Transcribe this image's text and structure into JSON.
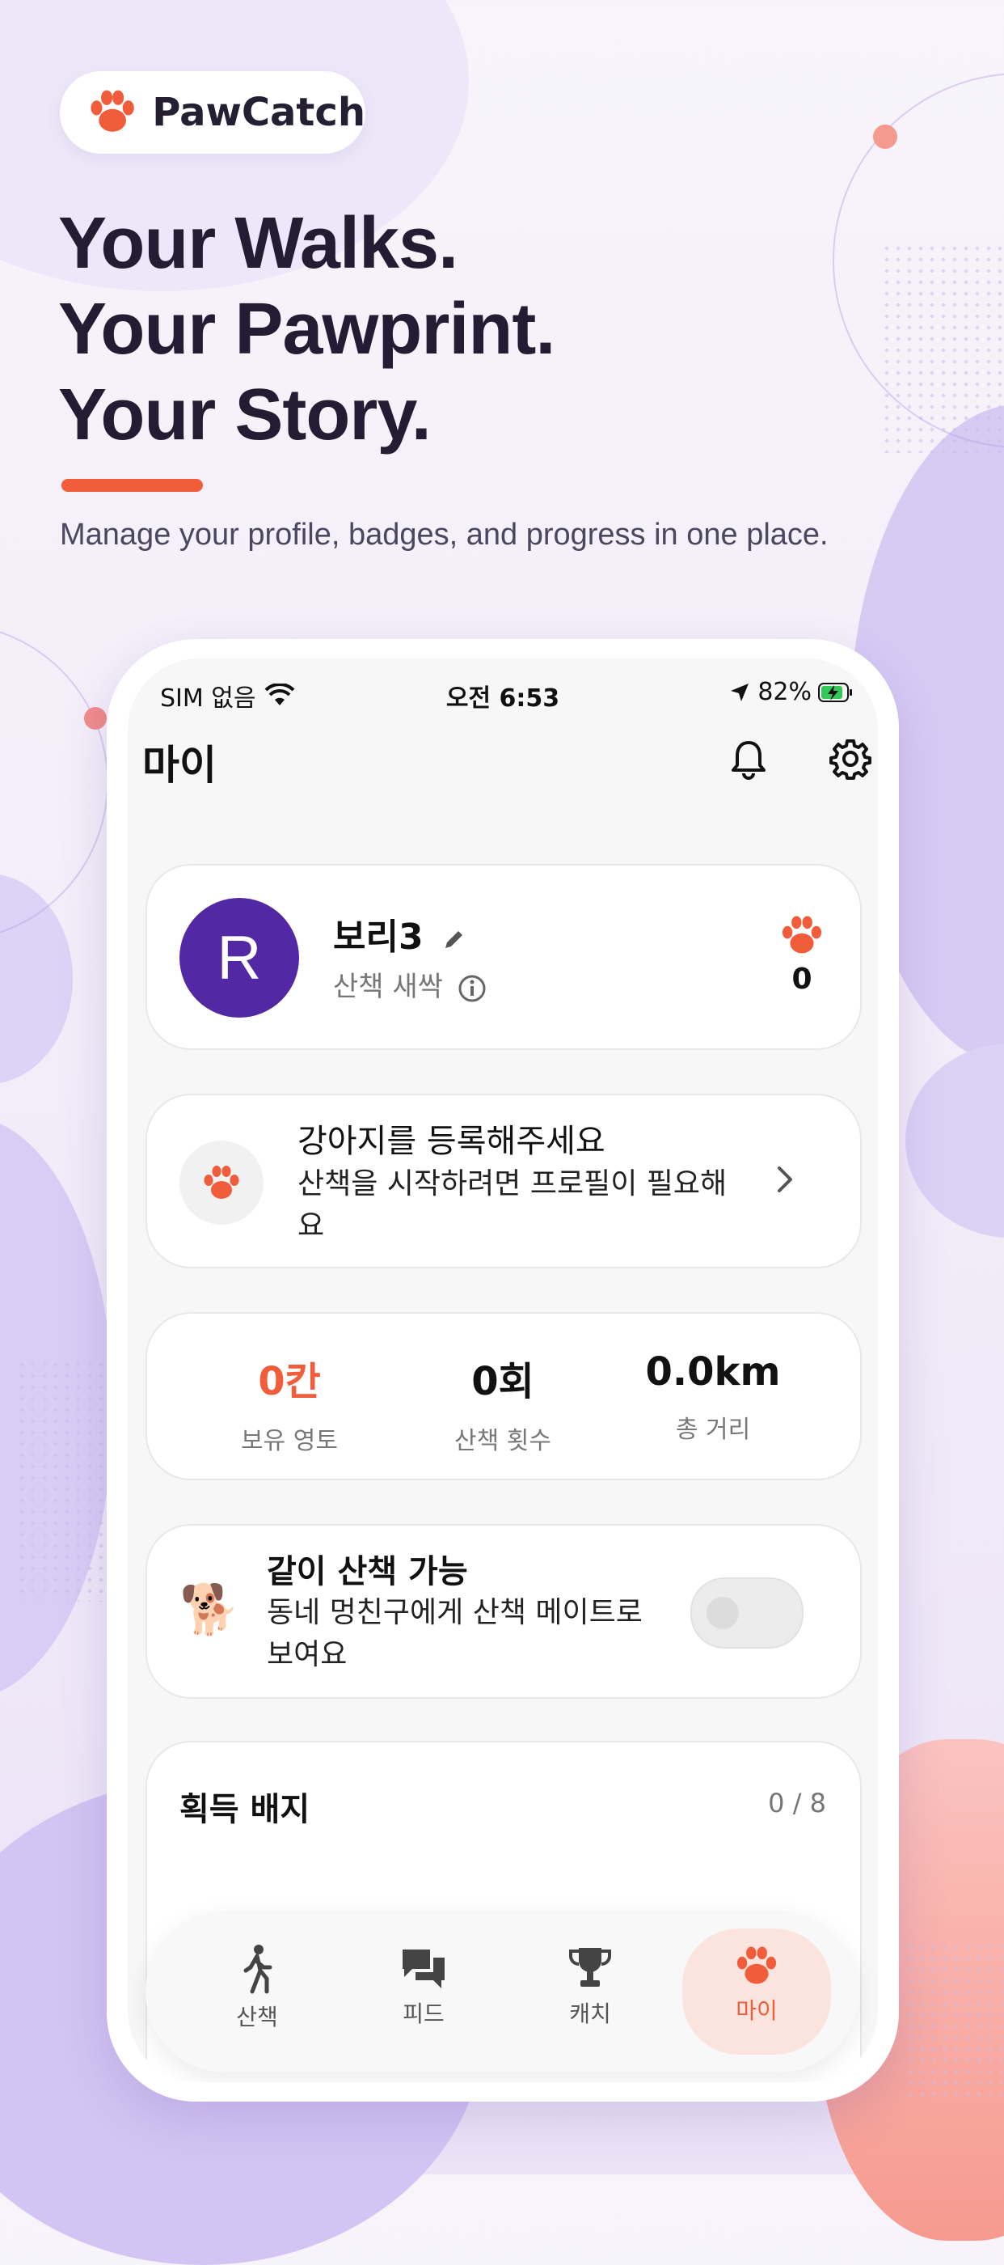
{
  "brand": {
    "name": "PawCatch"
  },
  "hero": {
    "line1": "Your Walks.",
    "line2": "Your Pawprint.",
    "line3": "Your Story.",
    "subtitle": "Manage your profile, badges, and progress in one place."
  },
  "status_bar": {
    "carrier": "SIM 없음",
    "time": "오전 6:53",
    "battery": "82%"
  },
  "screen": {
    "title": "마이"
  },
  "profile": {
    "avatar_letter": "R",
    "name": "보리3",
    "level": "산책 새싹",
    "paw_count": "0"
  },
  "register_dog": {
    "title": "강아지를 등록해주세요",
    "description": "산책을 시작하려면 프로필이 필요해요"
  },
  "stats": [
    {
      "value": "0칸",
      "label": "보유 영토"
    },
    {
      "value": "0회",
      "label": "산책 횟수"
    },
    {
      "value": "0.0km",
      "label": "총 거리"
    }
  ],
  "walk_together": {
    "emoji": "🐕",
    "title": "같이 산책 가능",
    "description": "동네 멍친구에게 산책 메이트로 보여요",
    "enabled": false
  },
  "badges": {
    "title": "획득 배지",
    "count": "0 / 8"
  },
  "nav": [
    {
      "label": "산책",
      "icon": "walk-icon"
    },
    {
      "label": "피드",
      "icon": "chat-icon"
    },
    {
      "label": "캐치",
      "icon": "trophy-icon"
    },
    {
      "label": "마이",
      "icon": "paw-icon",
      "active": true
    }
  ],
  "colors": {
    "accent": "#f15c3b",
    "avatar": "#5328a4",
    "headline": "#221d33"
  }
}
